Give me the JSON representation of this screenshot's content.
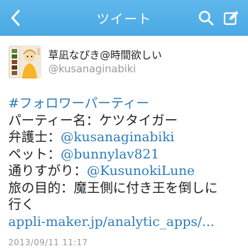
{
  "header": {
    "title": "ツイート",
    "back_icon": "chevron-left-icon",
    "search_icon": "search-icon",
    "compose_icon": "compose-icon",
    "bar_color": "#55b0e8"
  },
  "tweet": {
    "display_name": "草凪なぴき@時間欲しい",
    "screen_name": "@kusanaginabiki",
    "avatar_icon": "avatar-image",
    "lines": {
      "hashtag": "#フォロワーパーティー",
      "party_name": "パーティー名：ケツタイガー",
      "lawyer_label": "弁護士：",
      "lawyer_handle": "@kusanaginabiki",
      "pet_label": "ペット：",
      "pet_handle": "@bunnylav821",
      "passerby_label": "通りすがり：",
      "passerby_handle": "@KusunokiLune",
      "goal_line1": "旅の目的：魔王側に付き王を倒しに",
      "goal_line2": "行く",
      "link": "appli-maker.jp/analytic_apps/..."
    },
    "timestamp": "2013/09/11 11:17",
    "link_color": "#2b7bb9"
  }
}
